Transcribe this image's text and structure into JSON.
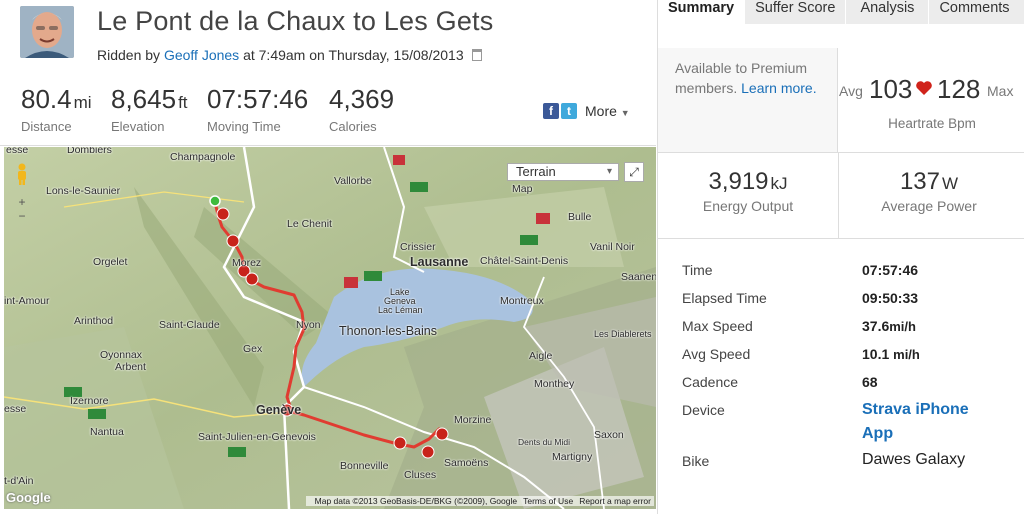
{
  "activity": {
    "title": "Le Pont de la Chaux to Les Gets",
    "ridden_by_prefix": "Ridden by",
    "athlete": "Geoff Jones",
    "when": "at 7:49am on Thursday, 15/08/2013"
  },
  "stats": [
    {
      "value": "80.4",
      "unit": "mi",
      "label": "Distance"
    },
    {
      "value": "8,645",
      "unit": "ft",
      "label": "Elevation"
    },
    {
      "value": "07:57:46",
      "unit": "",
      "label": "Moving Time"
    },
    {
      "value": "4,369",
      "unit": "",
      "label": "Calories"
    }
  ],
  "share": {
    "facebook": "f",
    "twitter": "t",
    "more_label": "More"
  },
  "map": {
    "type_select": "Terrain",
    "attribution": "Map data ©2013 GeoBasis-DE/BKG (©2009), Google",
    "terms": "Terms of Use",
    "report": "Report a map error",
    "logo": "Google",
    "zoom_in": "+",
    "zoom_out": "−",
    "labels": {
      "dombiers": "Dombiers",
      "champagnole": "Champagnole",
      "lons": "Lons-le-Saunier",
      "vallorbe": "Vallorbe",
      "romont": "Romont",
      "bulle": "Bulle",
      "lechenit": "Le Chenit",
      "crissier": "Crissier",
      "lausanne": "Lausanne",
      "chatel": "Châtel-Saint-Denis",
      "orgelet": "Orgelet",
      "morez": "Morez",
      "saanen": "Saanen",
      "amour": "int-Amour",
      "lake": "Lake",
      "geneva": "Geneva",
      "leman": "Lac Léman",
      "montreux": "Montreux",
      "arinthod": "Arinthod",
      "stclaude": "Saint-Claude",
      "nyon": "Nyon",
      "thonon": "Thonon-les-Bains",
      "gex": "Gex",
      "aigle": "Aigle",
      "oyonnax": "Oyonnax",
      "arbent": "Arbent",
      "monthey": "Monthey",
      "izernore": "Izernore",
      "esse": "esse",
      "geneve": "Genève",
      "morzine": "Morzine",
      "nantua": "Nantua",
      "stjulien": "Saint-Julien-en-Genevois",
      "saxon": "Saxon",
      "martigny": "Martigny",
      "bonneville": "Bonneville",
      "cluses": "Cluses",
      "samoens": "Samoëns",
      "dain": "t-d'Ain",
      "valeur": "Vanil Noir",
      "diablerets": "Les Diablerets",
      "dents": "Dents du Midi",
      "map_word": "Map"
    }
  },
  "tabs": [
    "Summary",
    "Suffer Score",
    "Analysis",
    "Comments"
  ],
  "premium": {
    "line1": "Available to Premium",
    "line2_prefix": "members.",
    "learn_more": "Learn more."
  },
  "heartrate": {
    "avg_label": "Avg",
    "avg": "103",
    "max": "128",
    "max_label": "Max",
    "label": "Heartrate",
    "unit": "Bpm"
  },
  "energy": {
    "value": "3,919",
    "unit": "kJ",
    "label": "Energy Output"
  },
  "power": {
    "value": "137",
    "unit": "W",
    "label": "Average Power"
  },
  "details": [
    {
      "key": "Time",
      "value": "07:57:46",
      "unit": ""
    },
    {
      "key": "Elapsed Time",
      "value": "09:50:33",
      "unit": ""
    },
    {
      "key": "Max Speed",
      "value": "37.6",
      "unit": "mi/h"
    },
    {
      "key": "Avg Speed",
      "value": "10.1",
      "unit": "mi/h"
    },
    {
      "key": "Cadence",
      "value": "68",
      "unit": ""
    }
  ],
  "device": {
    "key": "Device",
    "line1": "Strava iPhone",
    "line2": "App"
  },
  "bike": {
    "key": "Bike",
    "value": "Dawes Galaxy"
  },
  "colors": {
    "route": "#e03c31",
    "link": "#1a6fb8",
    "heart": "#d0231b",
    "lake": "#a9c2df"
  }
}
